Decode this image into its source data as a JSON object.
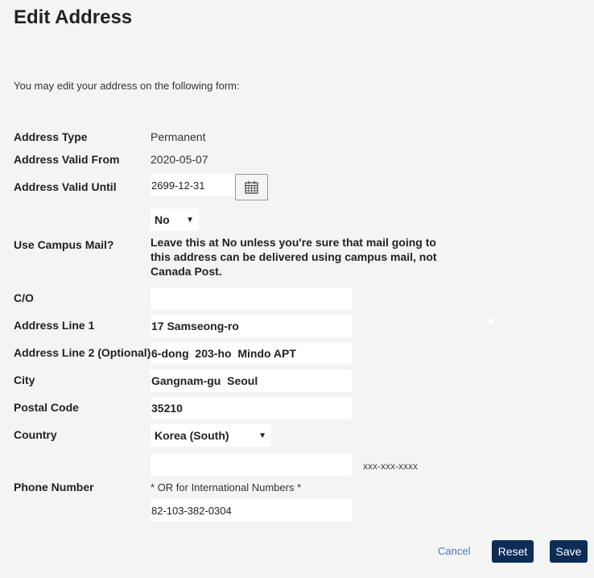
{
  "page": {
    "title": "Edit Address",
    "intro": "You may edit your address on the following form:"
  },
  "form": {
    "address_type": {
      "label": "Address Type",
      "value": "Permanent"
    },
    "valid_from": {
      "label": "Address Valid From",
      "value": "2020-05-07"
    },
    "valid_until": {
      "label": "Address Valid Until",
      "value": "2699-12-31",
      "icon": "calendar-icon"
    },
    "campus_mail": {
      "label": "Use Campus Mail?",
      "selected": "No",
      "note": "Leave this at No unless you're sure that mail going to this address can be delivered using campus mail, not Canada Post."
    },
    "co": {
      "label": "C/O",
      "value": ""
    },
    "line1": {
      "label": "Address Line 1",
      "value": "17 Samseong-ro"
    },
    "line2": {
      "label": "Address Line 2 (Optional)",
      "value": "6-dong  203-ho  Mindo APT"
    },
    "city": {
      "label": "City",
      "value": "Gangnam-gu  Seoul"
    },
    "postal": {
      "label": "Postal Code",
      "value": "35210"
    },
    "country": {
      "label": "Country",
      "selected": "Korea (South)"
    },
    "phone": {
      "label": "Phone Number",
      "local_value": "",
      "format_hint": "xxx-xxx-xxxx",
      "intl_note": "* OR for International Numbers *",
      "intl_value": "82-103-382-0304"
    }
  },
  "actions": {
    "cancel": "Cancel",
    "reset": "Reset",
    "save": "Save"
  }
}
